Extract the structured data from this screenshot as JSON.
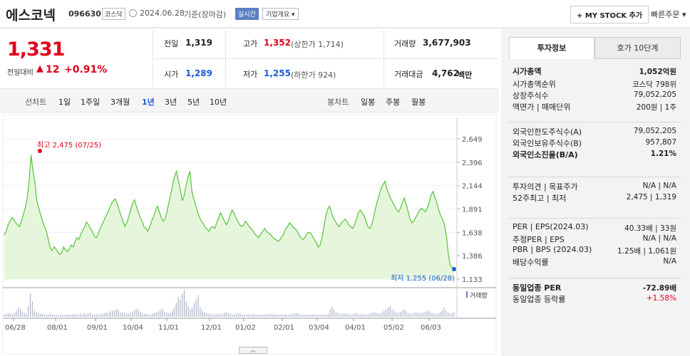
{
  "header": {
    "name": "에스코넥",
    "code": "096630",
    "market": "코스닥",
    "date": "2024.06.28",
    "basis": "기준(장마감)",
    "realtime": "실시간",
    "company_btn": "기업개요",
    "mystock": "+ MY STOCK 추가",
    "quick_order": "빠른주문"
  },
  "price": {
    "current": "1,331",
    "change_label": "전일대비",
    "change": "12",
    "rate": "+0.91%"
  },
  "stats": {
    "prev": {
      "label": "전일",
      "value": "1,319"
    },
    "high": {
      "label": "고가",
      "value": "1,352",
      "sub": "(상한가 1,714)"
    },
    "volume": {
      "label": "거래량",
      "value": "3,677,903"
    },
    "open": {
      "label": "시가",
      "value": "1,289"
    },
    "low": {
      "label": "저가",
      "value": "1,255",
      "sub": "(하한가 924)"
    },
    "amount": {
      "label": "거래대금",
      "value": "4,762",
      "unit": "백만"
    }
  },
  "line_tabs": {
    "label": "선차트",
    "items": [
      "1일",
      "1주일",
      "3개월",
      "1년",
      "3년",
      "5년",
      "10년"
    ]
  },
  "candle_tabs": {
    "label": "봉차트",
    "items": [
      "일봉",
      "주봉",
      "월봉"
    ]
  },
  "chart_data": {
    "type": "area",
    "period": "1년",
    "y_ticks": [
      "2,649",
      "2,396",
      "2,144",
      "1,891",
      "1,638",
      "1,386",
      "1,133"
    ],
    "ylim": [
      1133,
      2649
    ],
    "x_labels": [
      "06/28",
      "08/01",
      "09/01",
      "10/04",
      "11/01",
      "12/01",
      "01/02",
      "02/01",
      "03/04",
      "04/01",
      "05/02",
      "06/03"
    ],
    "values": [
      1610,
      1650,
      1720,
      1760,
      1800,
      1780,
      1740,
      1720,
      1700,
      1760,
      1840,
      1900,
      2010,
      2200,
      2475,
      2300,
      2180,
      1980,
      1900,
      1830,
      1760,
      1700,
      1650,
      1560,
      1470,
      1440,
      1480,
      1460,
      1420,
      1400,
      1420,
      1480,
      1450,
      1430,
      1460,
      1500,
      1480,
      1540,
      1580,
      1560,
      1620,
      1660,
      1700,
      1750,
      1720,
      1680,
      1650,
      1600,
      1580,
      1620,
      1680,
      1720,
      1760,
      1810,
      1850,
      1900,
      1950,
      1980,
      2000,
      1950,
      1880,
      1820,
      1760,
      1700,
      1740,
      1800,
      1880,
      1950,
      1990,
      1920,
      1860,
      1800,
      1760,
      1700,
      1680,
      1650,
      1700,
      1760,
      1810,
      1870,
      1920,
      1860,
      1800,
      1760,
      1780,
      1860,
      1960,
      2050,
      2150,
      2250,
      2300,
      2190,
      2100,
      1980,
      2040,
      2150,
      2240,
      2300,
      2090,
      2000,
      1930,
      1860,
      1800,
      1760,
      1730,
      1690,
      1670,
      1650,
      1690,
      1700,
      1680,
      1740,
      1800,
      1850,
      1810,
      1760,
      1720,
      1760,
      1820,
      1880,
      1850,
      1800,
      1760,
      1720,
      1700,
      1720,
      1760,
      1730,
      1700,
      1680,
      1650,
      1620,
      1600,
      1580,
      1620,
      1650,
      1680,
      1650,
      1630,
      1620,
      1590,
      1570,
      1560,
      1540,
      1560,
      1590,
      1620,
      1680,
      1700,
      1740,
      1720,
      1690,
      1680,
      1650,
      1610,
      1580,
      1560,
      1580,
      1620,
      1640,
      1630,
      1600,
      1560,
      1530,
      1480,
      1500,
      1580,
      1700,
      1820,
      1890,
      1920,
      1850,
      1790,
      1760,
      1720,
      1700,
      1740,
      1760,
      1780,
      1760,
      1720,
      1700,
      1680,
      1720,
      1780,
      1850,
      1880,
      1850,
      1820,
      1760,
      1700,
      1680,
      1720,
      1800,
      1900,
      1980,
      2050,
      2120,
      2160,
      2190,
      2100,
      2050,
      2000,
      1960,
      1920,
      1880,
      1860,
      1900,
      1960,
      2010,
      1940,
      1860,
      1780,
      1740,
      1760,
      1800,
      1840,
      1880,
      1900,
      1880,
      1860,
      1900,
      1960,
      2040,
      2080,
      2020,
      1960,
      1880,
      1820,
      1780,
      1720,
      1600,
      1410,
      1280,
      1260,
      1255
    ],
    "volume": [
      3,
      4,
      5,
      4,
      3,
      5,
      8,
      12,
      10,
      6,
      5,
      4,
      14,
      30,
      20,
      8,
      6,
      5,
      4,
      4,
      3,
      3,
      3,
      4,
      3,
      3,
      3,
      2,
      3,
      3,
      2,
      3,
      3,
      3,
      3,
      4,
      3,
      3,
      4,
      3,
      5,
      4,
      4,
      5,
      3,
      3,
      4,
      3,
      3,
      4,
      5,
      6,
      5,
      7,
      8,
      8,
      10,
      9,
      6,
      5,
      5,
      4,
      4,
      5,
      6,
      8,
      10,
      9,
      7,
      5,
      4,
      4,
      3,
      3,
      4,
      5,
      6,
      7,
      9,
      10,
      7,
      6,
      5,
      5,
      8,
      12,
      18,
      25,
      22,
      30,
      35,
      20,
      14,
      10,
      12,
      18,
      22,
      28,
      12,
      8,
      6,
      5,
      4,
      4,
      3,
      3,
      3,
      4,
      4,
      3,
      5,
      6,
      5,
      4,
      3,
      3,
      4,
      5,
      4,
      3,
      3,
      3,
      3,
      3,
      3,
      4,
      3,
      3,
      3,
      3,
      3,
      3,
      3,
      4,
      4,
      3,
      3,
      3,
      3,
      3,
      3,
      3,
      3,
      3,
      4,
      4,
      5,
      4,
      3,
      3,
      3,
      3,
      3,
      3,
      3,
      3,
      3,
      3,
      3,
      3,
      3,
      3,
      4,
      10,
      14,
      9,
      6,
      5,
      4,
      4,
      4,
      4,
      4,
      3,
      3,
      4,
      5,
      4,
      3,
      4,
      3,
      3,
      3,
      4,
      5,
      6,
      5,
      4,
      4,
      6,
      8,
      10,
      12,
      14,
      10,
      8,
      6,
      5,
      6,
      8,
      10,
      7,
      5,
      4,
      4,
      5,
      6,
      5,
      5,
      5,
      6,
      7,
      8,
      6,
      5,
      4,
      4,
      4,
      6,
      8,
      12,
      8,
      5,
      4,
      5,
      6
    ],
    "max_marker": {
      "label": "최고 2,475 (07/25)"
    },
    "min_marker": {
      "label": "최저 1,255 (06/28)"
    },
    "volume_legend": "거래량"
  },
  "right_tabs": [
    "투자정보",
    "호가 10단계"
  ],
  "info": {
    "g1": [
      {
        "label": "시가총액",
        "value": "1,052억원",
        "bold": true
      },
      {
        "label": "시가총액순위",
        "value": "코스닥 798위"
      },
      {
        "label": "상장주식수",
        "value": "79,052,205"
      },
      {
        "label": "액면가 | 매매단위",
        "value": "200원 | 1주"
      }
    ],
    "g2": [
      {
        "label": "외국인한도주식수(A)",
        "value": "79,052,205"
      },
      {
        "label": "외국인보유주식수(B)",
        "value": "957,807"
      },
      {
        "label": "외국인소진율(B/A)",
        "value": "1.21%",
        "bold": true
      }
    ],
    "g3": [
      {
        "label": "투자의견 | 목표주가",
        "value": "N/A | N/A"
      },
      {
        "label": "52주최고 | 최저",
        "value": "2,475 | 1,319"
      }
    ],
    "g4": [
      {
        "label": "PER | EPS(2024.03)",
        "value": "40.33배 | 33원"
      },
      {
        "label": "추정PER | EPS",
        "value": "N/A | N/A"
      },
      {
        "label": "PBR | BPS (2024.03)",
        "value": "1.25배 | 1,061원"
      },
      {
        "label": "배당수익률",
        "value": "N/A"
      }
    ],
    "g5": [
      {
        "label": "동일업종 PER",
        "value": "-72.89배",
        "bold": true
      },
      {
        "label": "동일업종 등락률",
        "value": "+1.58%",
        "color": "#e0001b"
      }
    ]
  },
  "colors": {
    "up": "#e0001b",
    "down": "#1b5bd6",
    "line": "#55c23a",
    "fill": "#e6f6dc"
  }
}
